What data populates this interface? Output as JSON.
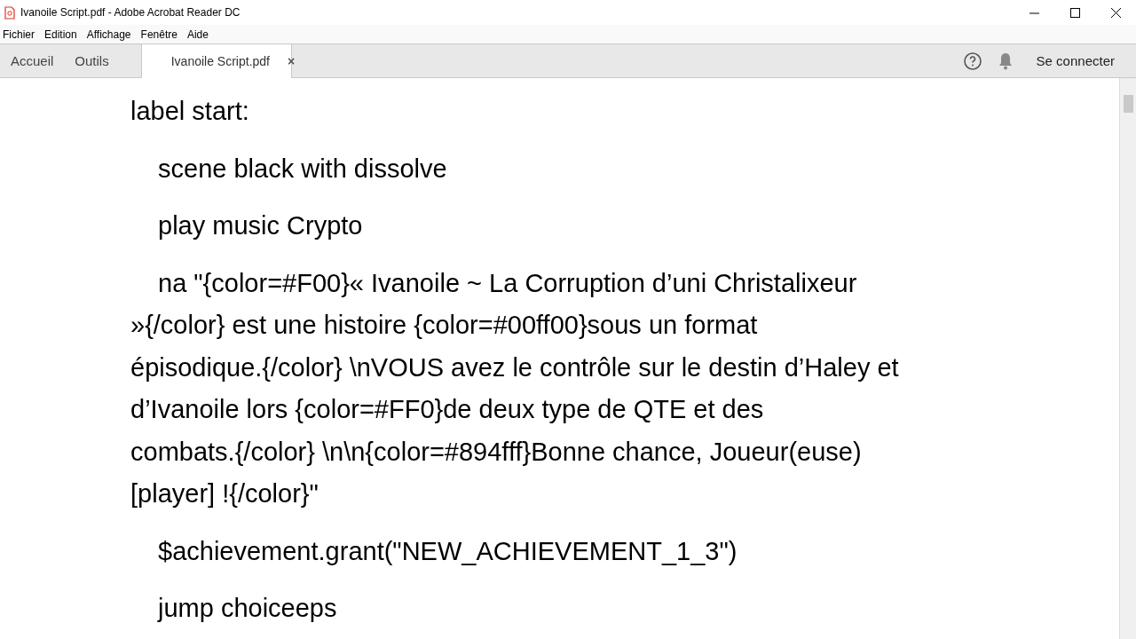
{
  "window": {
    "title": "Ivanoile Script.pdf - Adobe Acrobat Reader DC"
  },
  "menu": [
    "Fichier",
    "Edition",
    "Affichage",
    "Fenêtre",
    "Aide"
  ],
  "tabs": [
    {
      "label": "Accueil",
      "kind": "nav",
      "selected": false
    },
    {
      "label": "Outils",
      "kind": "nav",
      "selected": false
    },
    {
      "label": "Ivanoile Script.pdf",
      "kind": "document",
      "selected": true,
      "close": "×"
    }
  ],
  "account": {
    "sign_in": "Se connecter"
  },
  "document": {
    "paragraphs": [
      {
        "kind": "label",
        "lines": [
          "label start:"
        ]
      },
      {
        "kind": "statement",
        "lines": [
          "scene black with dissolve"
        ]
      },
      {
        "kind": "statement",
        "lines": [
          "play music Crypto"
        ]
      },
      {
        "kind": "statement",
        "lines": [
          "na \"{color=#F00}« Ivanoile ~ La Corruption d’uni Christalixeur",
          "»{/color} est une histoire {color=#00ff00}sous un format",
          "épisodique.{/color} \\nVOUS avez le contrôle sur le destin d’Haley et",
          "d’Ivanoile lors {color=#FF0}de deux type de QTE et des",
          "combats.{/color} \\n\\n{color=#894fff}Bonne chance, Joueur(euse)",
          "[player] !{/color}\""
        ]
      },
      {
        "kind": "statement",
        "lines": [
          "$achievement.grant(\"NEW_ACHIEVEMENT_1_3\")"
        ]
      },
      {
        "kind": "statement",
        "lines": [
          "jump choiceeps"
        ]
      }
    ]
  }
}
